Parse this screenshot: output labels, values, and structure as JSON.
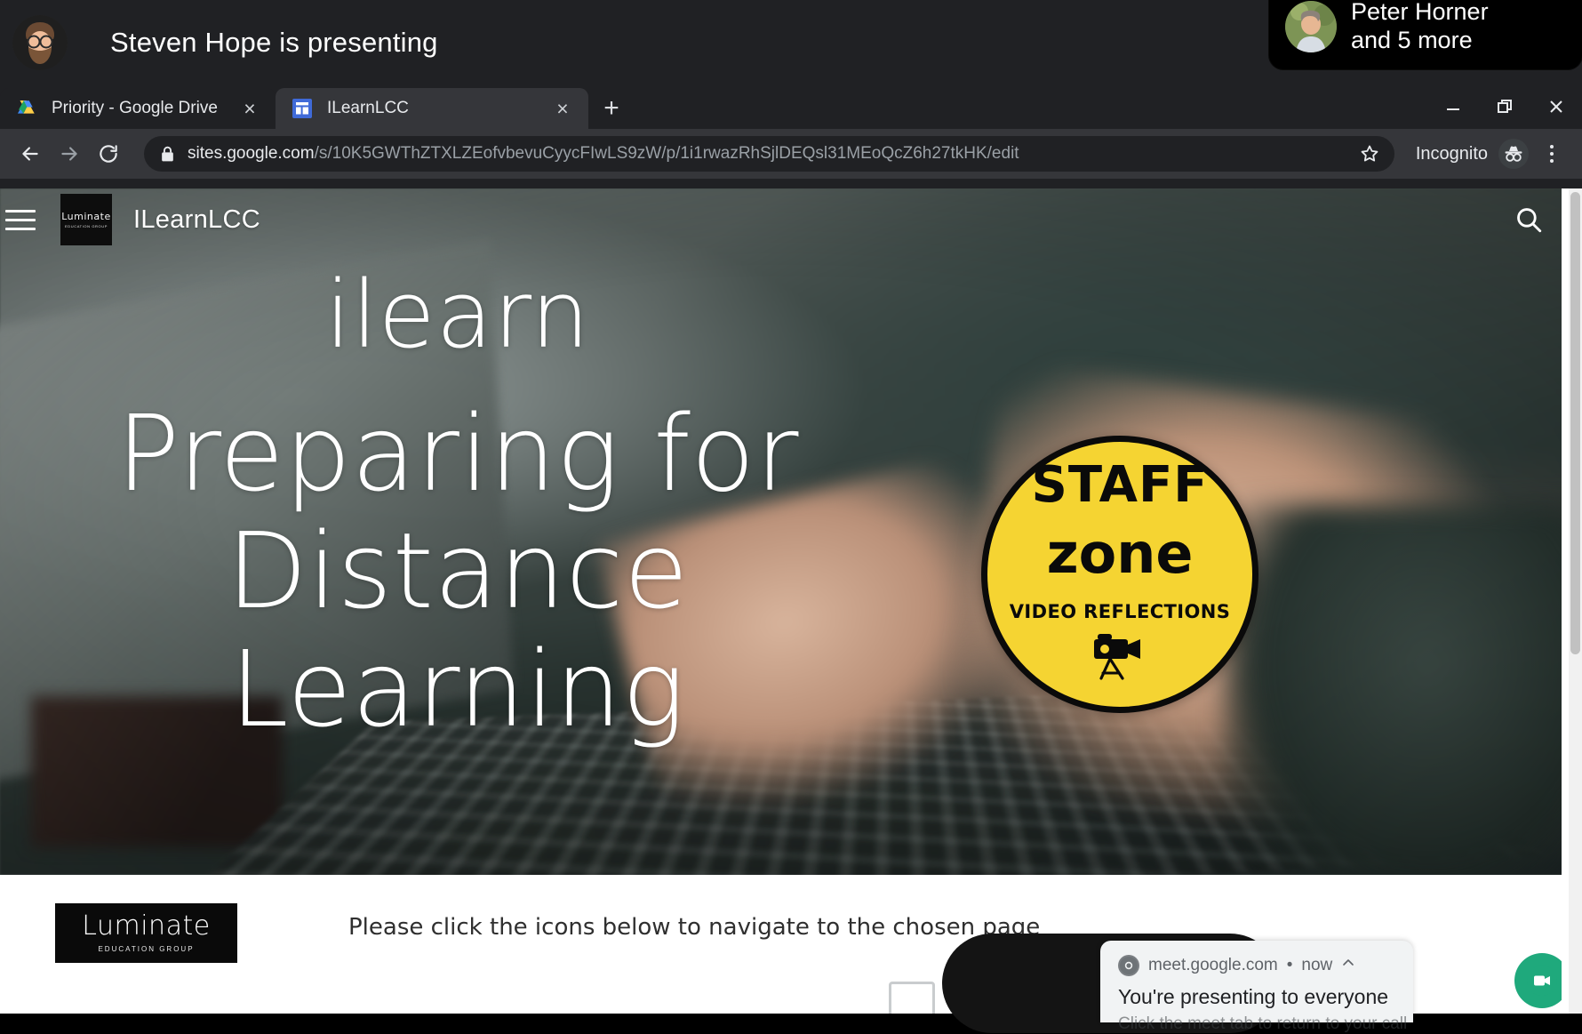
{
  "meet_bar": {
    "presenting_text": "Steven Hope is presenting",
    "presenter_avatar_name": "steven-hope-avatar",
    "participants_line1": "Peter Horner",
    "participants_line2": "and 5 more"
  },
  "browser": {
    "tabs": [
      {
        "title": "Priority - Google Drive",
        "favicon": "google-drive-icon",
        "active": false
      },
      {
        "title": "ILearnLCC",
        "favicon": "google-sites-icon",
        "active": true
      }
    ],
    "new_tab_label": "+",
    "close_label": "×",
    "window_controls": {
      "minimize": "–",
      "restore": "□",
      "close": "×"
    },
    "toolbar": {
      "back_icon": "back-arrow-icon",
      "forward_icon": "forward-arrow-icon",
      "reload_icon": "reload-icon",
      "lock_icon": "lock-icon",
      "url_host": "sites.google.com",
      "url_path": "/s/10K5GWThZTXLZEofvbevuCyycFIwLS9zW/p/1i1rwazRhSjlDEQsl31MEoQcZ6h27tkHK/edit",
      "star_icon": "star-icon",
      "incognito_label": "Incognito",
      "incognito_icon": "incognito-avatar-icon",
      "menu_icon": "three-dot-menu-icon"
    }
  },
  "site": {
    "menu_icon": "hamburger-menu-icon",
    "logo_text": "Luminate",
    "logo_subtext": "EDUCATION GROUP",
    "title": "ILearnLCC",
    "search_icon": "search-icon"
  },
  "hero": {
    "line1": "ilearn",
    "line2": "Preparing for Distance Learning",
    "badge": {
      "line1": "STAFF",
      "line2": "zone",
      "line3": "VIDEO REFLECTIONS",
      "icon": "video-camera-icon",
      "bg_color": "#f5d432",
      "fg_color": "#0a0a0a"
    }
  },
  "below": {
    "logo_text": "Luminate",
    "logo_subtext": "EDUCATION GROUP",
    "nav_hint": "Please click the icons below to navigate to the chosen page"
  },
  "notification": {
    "source": "meet.google.com",
    "separator": "•",
    "time": "now",
    "collapse_icon": "chevron-up-icon",
    "title": "You're presenting to everyone",
    "subtitle": "Click the meet tab to return to your call",
    "app_icon": "chrome-icon"
  },
  "floating": {
    "meet_icon": "present-video-icon",
    "meet_color": "#1fa97c"
  }
}
